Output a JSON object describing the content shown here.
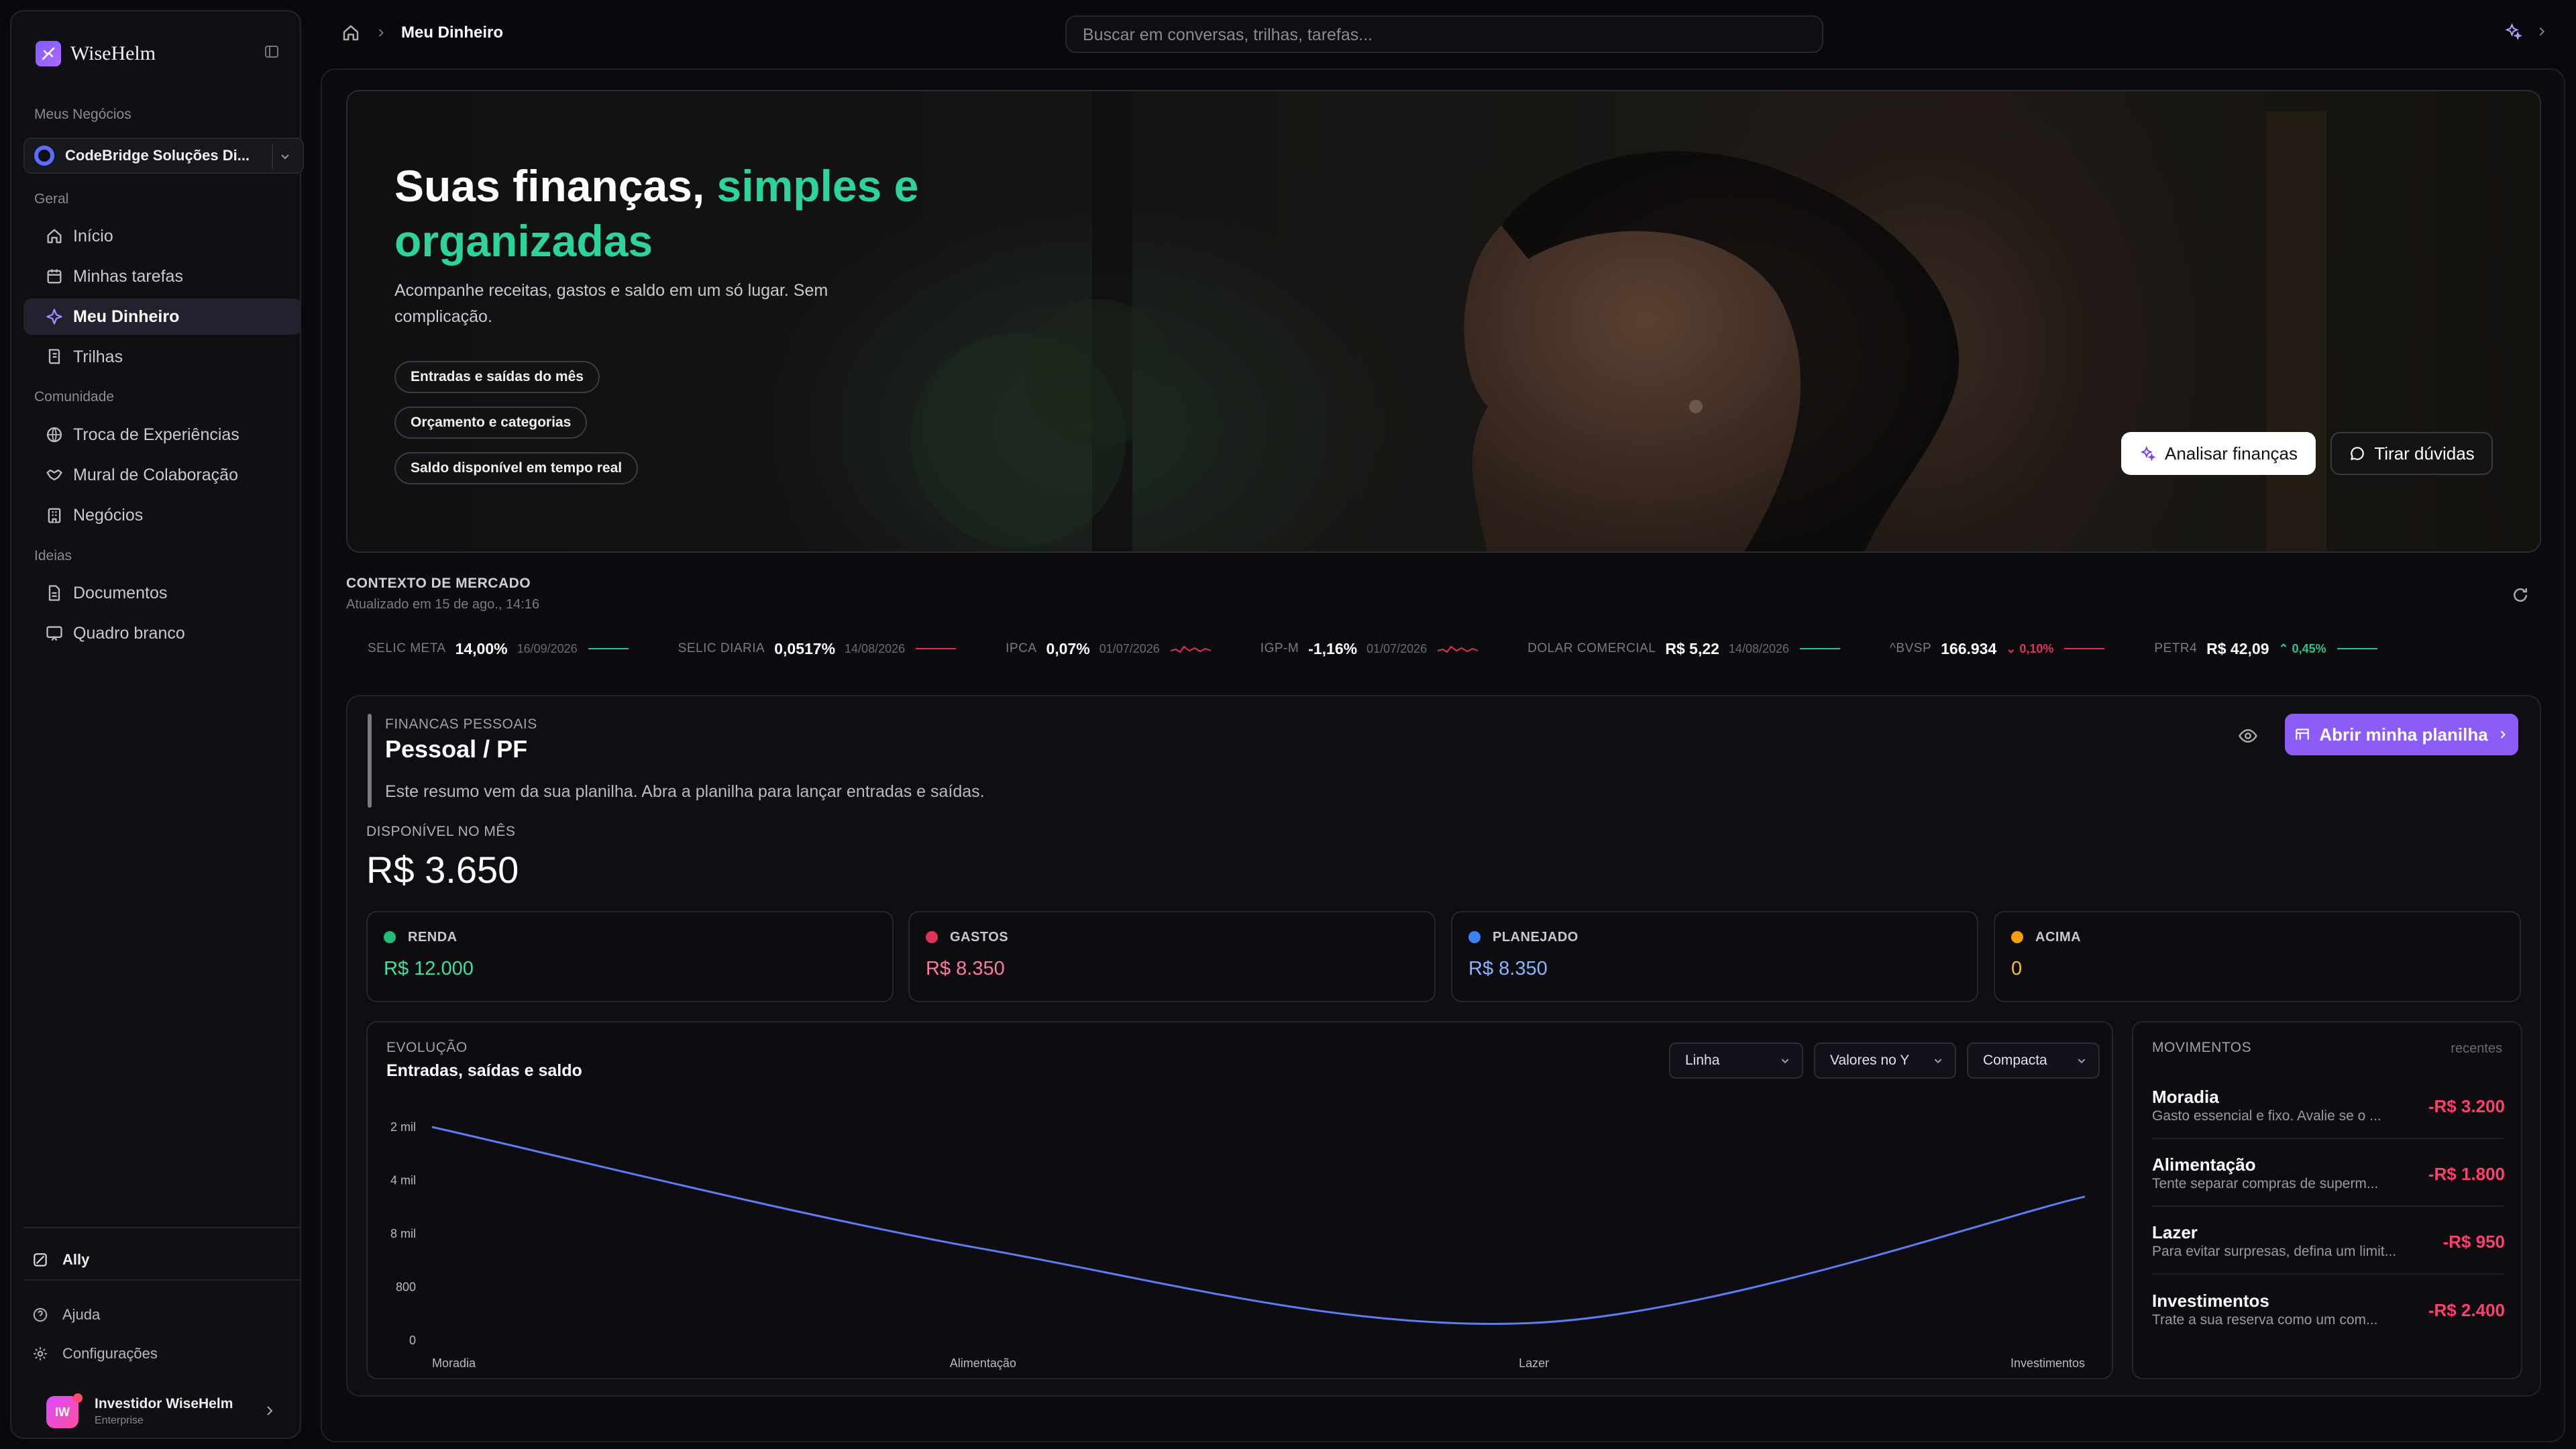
{
  "app": {
    "name": "WiseHelm"
  },
  "sidebar": {
    "business_section": "Meus Negócios",
    "business_name": "CodeBridge Soluções Di...",
    "sections": {
      "geral": "Geral",
      "comunidade": "Comunidade",
      "ideias": "Ideias"
    },
    "items": [
      {
        "label": "Início",
        "icon": "home-icon"
      },
      {
        "label": "Minhas tarefas",
        "icon": "calendar-icon"
      },
      {
        "label": "Meu Dinheiro",
        "icon": "sparkle-icon",
        "active": true
      },
      {
        "label": "Trilhas",
        "icon": "book-icon"
      },
      {
        "label": "Troca de Experiências",
        "icon": "globe-icon"
      },
      {
        "label": "Mural de Colaboração",
        "icon": "handshake-icon"
      },
      {
        "label": "Negócios",
        "icon": "building-icon"
      },
      {
        "label": "Documentos",
        "icon": "document-icon"
      },
      {
        "label": "Quadro branco",
        "icon": "whiteboard-icon"
      }
    ],
    "ally": "Ally",
    "help": "Ajuda",
    "settings": "Configurações",
    "user": {
      "initials": "IW",
      "name": "Investidor WiseHelm",
      "plan": "Enterprise"
    }
  },
  "topbar": {
    "breadcrumb": "Meu Dinheiro",
    "search_placeholder": "Buscar em conversas, trilhas, tarefas..."
  },
  "hero": {
    "title_a": "Suas finanças,",
    "title_b": "simples e organizadas",
    "description": "Acompanhe receitas, gastos e saldo em um só lugar. Sem complicação.",
    "chips": [
      "Entradas e saídas do mês",
      "Orçamento e categorias",
      "Saldo disponível em tempo real"
    ],
    "primary_button": "Analisar finanças",
    "secondary_button": "Tirar dúvidas"
  },
  "market": {
    "title": "CONTEXTO DE MERCADO",
    "updated": "Atualizado em 15 de ago., 14:16",
    "tickers": [
      {
        "label": "SELIC META",
        "value": "14,00%",
        "date": "16/09/2026",
        "spark": "flat",
        "color": "#2ec28a"
      },
      {
        "label": "SELIC DIARIA",
        "value": "0,0517%",
        "date": "14/08/2026",
        "spark": "flat",
        "color": "#e0335a"
      },
      {
        "label": "IPCA",
        "value": "0,07%",
        "date": "01/07/2026",
        "spark": "wave",
        "color": "#e0335a"
      },
      {
        "label": "IGP-M",
        "value": "-1,16%",
        "date": "01/07/2026",
        "spark": "wave",
        "color": "#e0335a"
      },
      {
        "label": "DOLAR COMERCIAL",
        "value": "R$ 5,22",
        "date": "14/08/2026",
        "spark": "flat",
        "color": "#2ec28a"
      },
      {
        "label": "^BVSP",
        "value": "166.934",
        "change": "0,10%",
        "dir": "down",
        "spark": "flat",
        "color": "#e0335a"
      },
      {
        "label": "PETR4",
        "value": "R$ 42,09",
        "change": "0,45%",
        "dir": "up",
        "spark": "flat",
        "color": "#2ec28a"
      }
    ]
  },
  "finance": {
    "eyebrow": "FINANCAS PESSOAIS",
    "title": "Pessoal / PF",
    "description": "Este resumo vem da sua planilha. Abra a planilha para lançar entradas e saídas.",
    "open_button": "Abrir minha planilha",
    "available_label": "DISPONÍVEL NO MÊS",
    "available_value": "R$ 3.650",
    "stats": [
      {
        "label": "RENDA",
        "value": "R$ 12.000",
        "dot": "#1fbf7a",
        "color": "#3ee0a0"
      },
      {
        "label": "GASTOS",
        "value": "R$ 8.350",
        "dot": "#e0335a",
        "color": "#ff7a9a"
      },
      {
        "label": "PLANEJADO",
        "value": "R$ 8.350",
        "dot": "#3b82f6",
        "color": "#8ab4ff"
      },
      {
        "label": "ACIMA",
        "value": "0",
        "dot": "#f59e0b",
        "color": "#fbbf24"
      }
    ]
  },
  "evolution": {
    "eyebrow": "EVOLUÇÃO",
    "title": "Entradas, saídas e saldo",
    "selects": [
      "Linha",
      "Valores no Y",
      "Compacta"
    ]
  },
  "chart_data": {
    "type": "line",
    "categories": [
      "Moradia",
      "Alimentação",
      "Lazer",
      "Investimentos"
    ],
    "y_tick_labels": [
      "2 mil",
      "4 mil",
      "8 mil",
      "800",
      "0"
    ],
    "series": [
      {
        "values": [
          3200,
          1800,
          950,
          2400
        ],
        "color": "#5b7ff0"
      }
    ]
  },
  "movements": {
    "title": "MOVIMENTOS",
    "tag": "recentes",
    "items": [
      {
        "title": "Moradia",
        "desc": "Gasto essencial e fixo. Avalie se o ...",
        "amount": "-R$ 3.200"
      },
      {
        "title": "Alimentação",
        "desc": "Tente separar compras de superm...",
        "amount": "-R$ 1.800"
      },
      {
        "title": "Lazer",
        "desc": "Para evitar surpresas, defina um limit...",
        "amount": "-R$ 950"
      },
      {
        "title": "Investimentos",
        "desc": "Trate a sua reserva como um com...",
        "amount": "-R$ 2.400"
      }
    ]
  }
}
